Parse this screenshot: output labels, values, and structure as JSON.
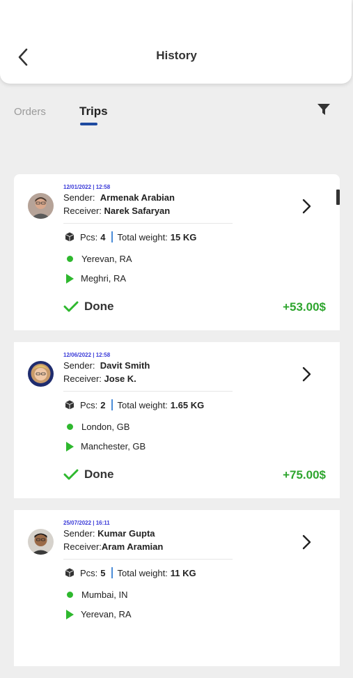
{
  "header": {
    "title": "History"
  },
  "tabs": [
    {
      "label": "Orders",
      "active": false
    },
    {
      "label": "Trips",
      "active": true
    }
  ],
  "colors": {
    "accent": "#1e4aa0",
    "status_green": "#2eb82e",
    "amount_green": "#2ea52e",
    "date_blue": "#3a3ad8"
  },
  "icons": [
    "back-arrow-icon",
    "filter-icon",
    "chevron-right-icon",
    "package-icon",
    "origin-dot-icon",
    "destination-play-icon",
    "check-icon"
  ],
  "trips": [
    {
      "date": "12/01/2022  |  12:58",
      "sender_label": "Sender:",
      "sender": "Armenak Arabian",
      "receiver_label": "Receiver:",
      "receiver": "Narek Safaryan",
      "pcs_label": "Pcs:",
      "pcs": "4",
      "weight_label": "Total weight:",
      "weight": "15 KG",
      "from": "Yerevan, RA",
      "to": "Meghri, RA",
      "status": "Done",
      "amount": "+53.00$"
    },
    {
      "date": "12/06/2022  |  12:58",
      "sender_label": "Sender:",
      "sender": "Davit Smith",
      "receiver_label": "Receiver:",
      "receiver": "Jose K.",
      "pcs_label": "Pcs:",
      "pcs": "2",
      "weight_label": "Total weight:",
      "weight": "1.65 KG",
      "from": "London, GB",
      "to": "Manchester, GB",
      "status": "Done",
      "amount": "+75.00$"
    },
    {
      "date": "25/07/2022  |  16:11",
      "sender_label": "Sender:",
      "sender": "Kumar Gupta",
      "receiver_label": "Receiver:",
      "receiver": "Aram Aramian",
      "pcs_label": "Pcs:",
      "pcs": "5",
      "weight_label": "Total weight:",
      "weight": "11 KG",
      "from": "Mumbai, IN",
      "to": "Yerevan, RA",
      "status": "",
      "amount": ""
    }
  ]
}
